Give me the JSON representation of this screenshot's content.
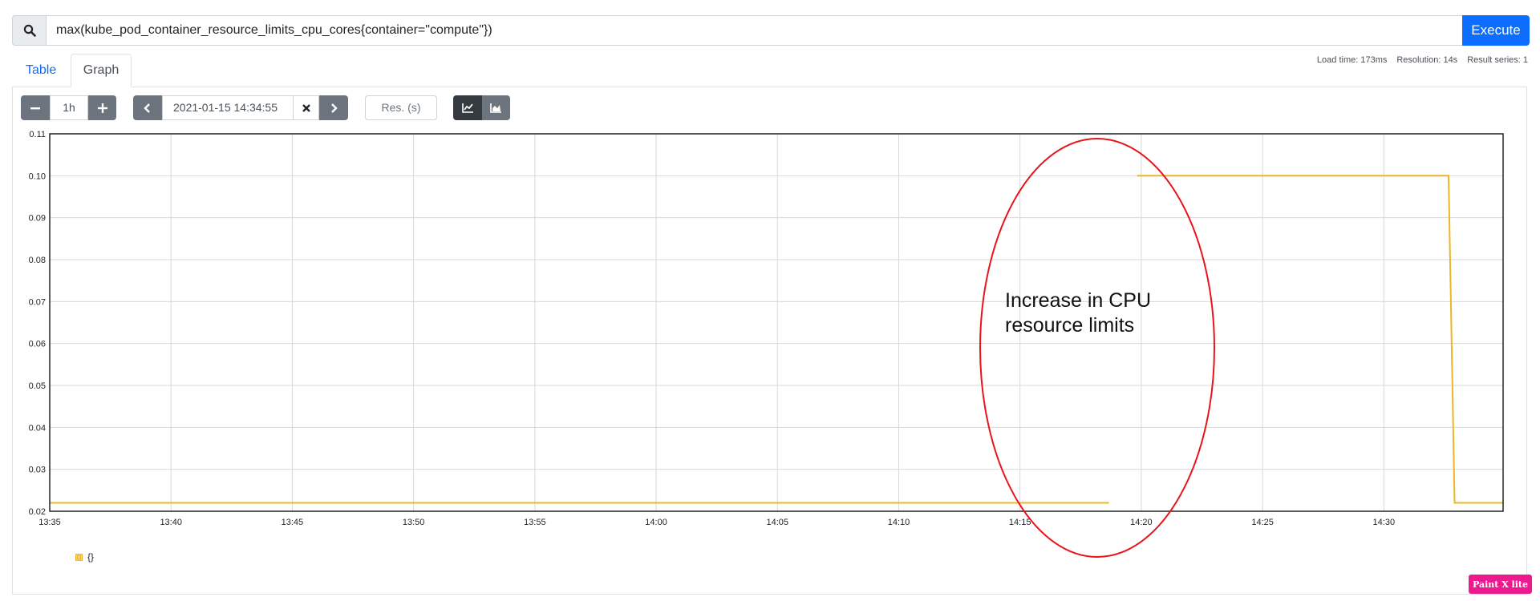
{
  "query": {
    "expression": "max(kube_pod_container_resource_limits_cpu_cores{container=\"compute\"})",
    "execute_label": "Execute",
    "icon": "search-icon"
  },
  "tabs": [
    {
      "label": "Table",
      "active": false
    },
    {
      "label": "Graph",
      "active": true
    }
  ],
  "stats": {
    "load_time": "Load time: 173ms",
    "resolution": "Resolution: 14s",
    "result_series": "Result series: 1"
  },
  "controls": {
    "range_minus_icon": "minus-icon",
    "range": "1h",
    "range_plus_icon": "plus-icon",
    "prev_icon": "chevron-left-icon",
    "end_time": "2021-01-15 14:34:55",
    "clear_icon": "close-icon",
    "next_icon": "chevron-right-icon",
    "resolution_placeholder": "Res. (s)",
    "unstacked_icon": "line-chart-icon",
    "stacked_icon": "area-chart-icon"
  },
  "legend": {
    "series_label": "{}",
    "color": "#f0b429"
  },
  "annotation": {
    "text_line1": "Increase in CPU",
    "text_line2": "resource limits",
    "color": "#e8131b"
  },
  "badge": {
    "text": "Paint X lite"
  },
  "chart_data": {
    "type": "line",
    "x_ticks": [
      "13:35",
      "13:40",
      "13:45",
      "13:50",
      "13:55",
      "14:00",
      "14:05",
      "14:10",
      "14:15",
      "14:20",
      "14:25",
      "14:30"
    ],
    "y_ticks": [
      "0.02",
      "0.03",
      "0.04",
      "0.05",
      "0.06",
      "0.07",
      "0.08",
      "0.09",
      "0.10",
      "0.11"
    ],
    "xlim": [
      "13:35:00",
      "14:34:55"
    ],
    "ylim": [
      0.02,
      0.11
    ],
    "grid": true,
    "series": [
      {
        "name": "{}",
        "color": "#f0b429",
        "segments": [
          [
            {
              "x": "13:35:00",
              "y": 0.022
            },
            {
              "x": "14:18:40",
              "y": 0.022
            }
          ],
          [
            {
              "x": "14:19:50",
              "y": 0.1
            },
            {
              "x": "14:32:40",
              "y": 0.1
            },
            {
              "x": "14:32:55",
              "y": 0.022
            },
            {
              "x": "14:34:55",
              "y": 0.022
            }
          ]
        ]
      }
    ]
  }
}
